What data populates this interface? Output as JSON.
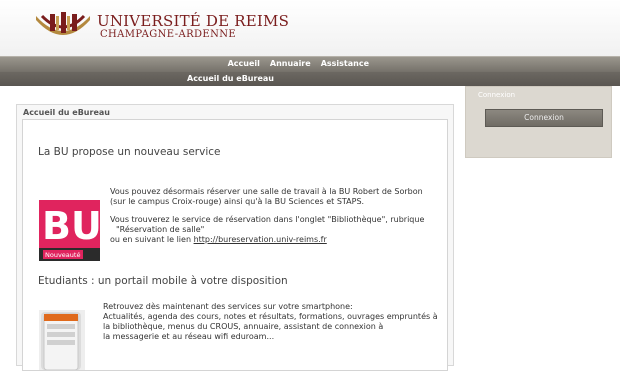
{
  "header": {
    "university_name": "Université de Reims",
    "university_sub": "Champagne-Ardenne"
  },
  "nav": {
    "items": [
      "Accueil",
      "Annuaire",
      "Assistance"
    ],
    "sub_item": "Accueil du eBureau"
  },
  "main": {
    "box_title": "Accueil du eBureau",
    "articles": [
      {
        "title": "La BU propose un nouveau service",
        "lines": [
          "Vous pouvez désormais réserver une salle de travail à la BU Robert de Sorbon",
          "(sur le campus Croix-rouge) ainsi qu'à la BU Sciences et STAPS.",
          "Vous trouverez le service de réservation dans l'onglet \"Bibliothèque\", rubrique",
          "\"Réservation de salle\"",
          "ou en suivant le lien"
        ],
        "link": "http://bureservation.univ-reims.fr",
        "image_text": "BU",
        "image_badge": "Nouveauté"
      },
      {
        "title": "Etudiants : un portail mobile à votre disposition",
        "lines": [
          "Retrouvez dès maintenant des services sur votre smartphone:",
          "Actualités, agenda des cours, notes et résultats, formations, ouvrages empruntés à",
          "la bibliothèque, menus du CROUS, annuaire, assistant de connexion à",
          "la messagerie et au réseau wifi eduroam..."
        ]
      }
    ]
  },
  "side": {
    "title": "Connexion",
    "button_label": "Connexion"
  },
  "colors": {
    "brand": "#7a1d1d",
    "nav": "#8a867e",
    "bu_pink": "#e0245e"
  }
}
